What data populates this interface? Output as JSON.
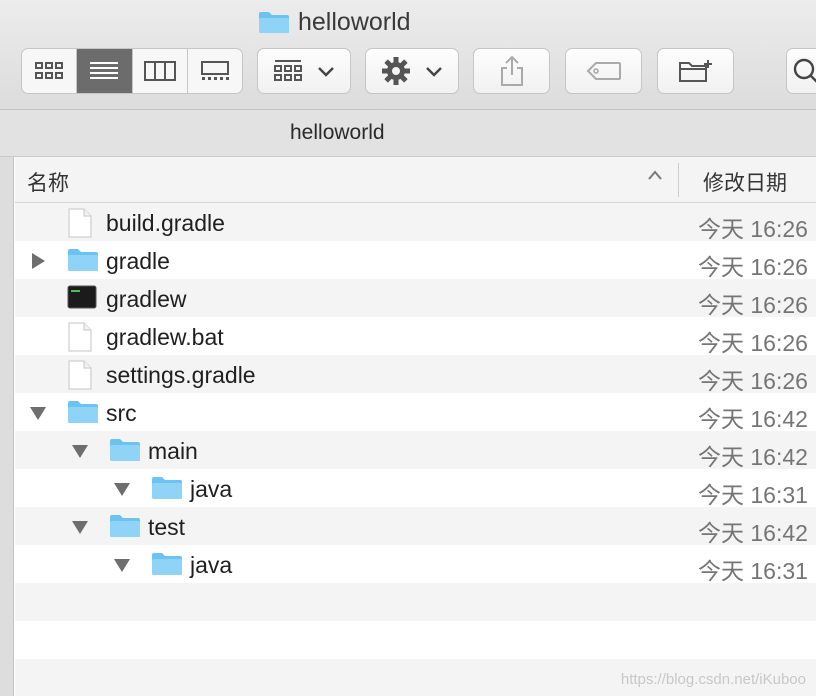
{
  "window": {
    "title": "helloworld"
  },
  "path_bar": {
    "label": "helloworld"
  },
  "toolbar": {
    "view_icons": [
      "grid-view-icon",
      "list-view-icon",
      "column-view-icon",
      "gallery-view-icon"
    ],
    "active_view": "list-view-icon",
    "group_icon": "group-icon",
    "action_icon": "gear-icon",
    "share_icon": "share-icon",
    "tag_icon": "tag-icon",
    "new_folder_icon": "new-folder-icon",
    "search_icon": "search-icon"
  },
  "columns": {
    "name": "名称",
    "modified": "修改日期"
  },
  "rows": [
    {
      "name": "build.gradle",
      "date": "今天 16:26",
      "kind": "document",
      "level": 0,
      "disclosure": "none"
    },
    {
      "name": "gradle",
      "date": "今天 16:26",
      "kind": "folder",
      "level": 0,
      "disclosure": "collapsed"
    },
    {
      "name": "gradlew",
      "date": "今天 16:26",
      "kind": "terminal",
      "level": 0,
      "disclosure": "none"
    },
    {
      "name": "gradlew.bat",
      "date": "今天 16:26",
      "kind": "document",
      "level": 0,
      "disclosure": "none"
    },
    {
      "name": "settings.gradle",
      "date": "今天 16:26",
      "kind": "document",
      "level": 0,
      "disclosure": "none"
    },
    {
      "name": "src",
      "date": "今天 16:42",
      "kind": "folder",
      "level": 0,
      "disclosure": "expanded"
    },
    {
      "name": "main",
      "date": "今天 16:42",
      "kind": "folder",
      "level": 1,
      "disclosure": "expanded"
    },
    {
      "name": "java",
      "date": "今天 16:31",
      "kind": "folder",
      "level": 2,
      "disclosure": "expanded"
    },
    {
      "name": "test",
      "date": "今天 16:42",
      "kind": "folder",
      "level": 1,
      "disclosure": "expanded"
    },
    {
      "name": "java",
      "date": "今天 16:31",
      "kind": "folder",
      "level": 2,
      "disclosure": "expanded"
    },
    {
      "name": "",
      "date": "",
      "kind": "empty",
      "level": 0,
      "disclosure": "none"
    },
    {
      "name": "",
      "date": "",
      "kind": "empty",
      "level": 0,
      "disclosure": "none"
    },
    {
      "name": "",
      "date": "",
      "kind": "empty",
      "level": 0,
      "disclosure": "none"
    }
  ],
  "watermark": "https://blog.csdn.net/iKuboo",
  "colors": {
    "folder": "#6cc3f2",
    "folder_tab": "#8fd3f7",
    "active_segment": "#6c6c6c"
  }
}
